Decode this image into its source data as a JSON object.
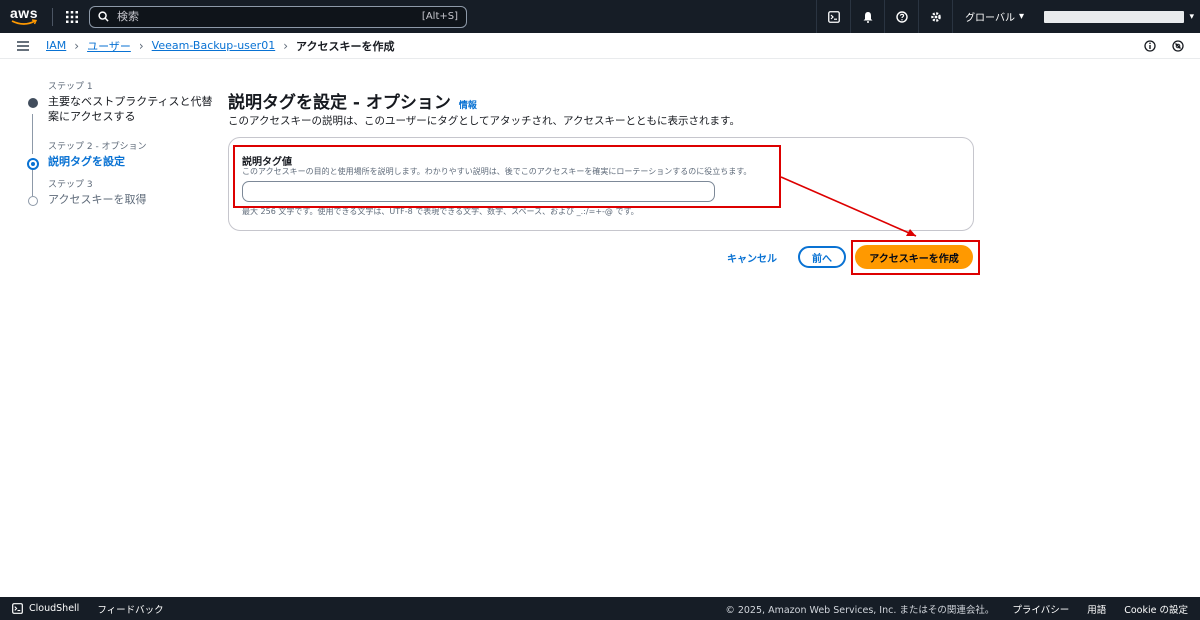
{
  "topnav": {
    "logo_text": "aws",
    "search_placeholder": "検索",
    "search_shortcut": "[Alt+S]",
    "region_label": "グローバル",
    "region_caret": "▾",
    "account_caret": "▾"
  },
  "breadcrumb": {
    "items": [
      "IAM",
      "ユーザー",
      "Veeam-Backup-user01"
    ],
    "current": "アクセスキーを作成",
    "separator": "›"
  },
  "steps": [
    {
      "num": "ステップ 1",
      "label": "主要なベストプラクティスと代替案にアクセスする",
      "state": "done"
    },
    {
      "num": "ステップ 2 - オプション",
      "label": "説明タグを設定",
      "state": "active"
    },
    {
      "num": "ステップ 3",
      "label": "アクセスキーを取得",
      "state": "todo"
    }
  ],
  "main": {
    "title": "説明タグを設定 - オプション",
    "info_link": "情報",
    "description": "このアクセスキーの説明は、このユーザーにタグとしてアタッチされ、アクセスキーとともに表示されます。",
    "field": {
      "label": "説明タグ値",
      "description": "このアクセスキーの目的と使用場所を説明します。わかりやすい説明は、後でこのアクセスキーを確実にローテーションするのに役立ちます。",
      "value": "",
      "constraint": "最大 256 文字です。使用できる文字は、UTF-8 で表現できる文字、数字、スペース、および _.:/=+-@ です。"
    },
    "buttons": {
      "cancel": "キャンセル",
      "prev": "前へ",
      "create": "アクセスキーを作成"
    }
  },
  "footer": {
    "cloudshell": "CloudShell",
    "feedback": "フィードバック",
    "copyright": "© 2025, Amazon Web Services, Inc. またはその関連会社。",
    "privacy": "プライバシー",
    "terms": "用語",
    "cookie": "Cookie の設定"
  },
  "colors": {
    "nav_bg": "#161d26",
    "link": "#0972d3",
    "primary_button": "#ff9900",
    "highlight": "#dd0000"
  }
}
